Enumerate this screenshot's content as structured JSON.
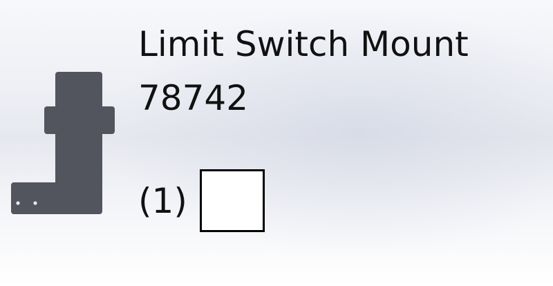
{
  "part": {
    "name": "Limit Switch Mount",
    "number": "78742",
    "quantity_label": "(1)",
    "checked": false,
    "colors": {
      "part_fill": "#52545e",
      "hole": "#e8e8ee"
    },
    "icon": "sheet-metal-part-silhouette"
  }
}
